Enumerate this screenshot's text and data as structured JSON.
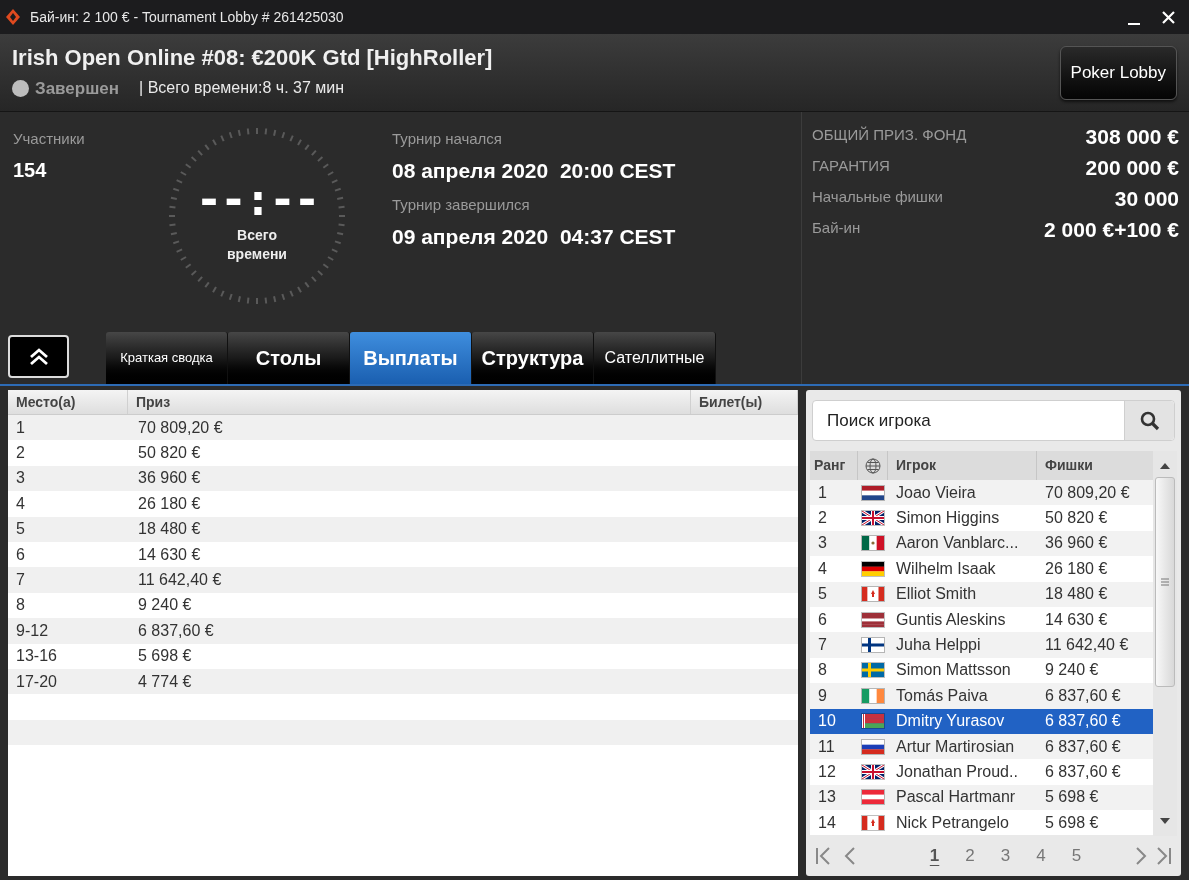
{
  "window": {
    "title": "Бай-ин: 2 100 € - Tournament Lobby # 261425030"
  },
  "header": {
    "title": "Irish Open Online #08: €200K Gtd [HighRoller]",
    "status": "Завершен",
    "duration": "| Всего времени:8 ч. 37 мин",
    "lobby_button": "Poker Lobby"
  },
  "info": {
    "participants_label": "Участники",
    "participants": "154",
    "clock": "--:--",
    "clock_caption": "Всего времени",
    "started_label": "Турнир начался",
    "started": "08 апреля 2020  20:00 CEST",
    "ended_label": "Турнир завершился",
    "ended": "09 апреля 2020  04:37 CEST",
    "stats": [
      {
        "label": "ОБЩИЙ ПРИЗ. ФОНД",
        "value": "308 000 €"
      },
      {
        "label": "ГАРАНТИЯ",
        "value": "200 000 €"
      },
      {
        "label": "Начальные фишки",
        "value": "30 000"
      },
      {
        "label": "Бай-ин",
        "value": "2 000 €+100 €"
      }
    ]
  },
  "tabs": [
    {
      "label": "Краткая сводка",
      "selected": false,
      "compact": true
    },
    {
      "label": "Столы",
      "selected": false,
      "compact": false
    },
    {
      "label": "Выплаты",
      "selected": true,
      "compact": false
    },
    {
      "label": "Структура",
      "selected": false,
      "compact": false
    },
    {
      "label": "Сателлитные",
      "selected": false,
      "compact": true
    }
  ],
  "payouts": {
    "columns": [
      "Место(а)",
      "Приз",
      "Билет(ы)"
    ],
    "rows": [
      [
        "1",
        "70 809,20 €"
      ],
      [
        "2",
        "50 820 €"
      ],
      [
        "3",
        "36 960 €"
      ],
      [
        "4",
        "26 180 €"
      ],
      [
        "5",
        "18 480 €"
      ],
      [
        "6",
        "14 630 €"
      ],
      [
        "7",
        "11 642,40 €"
      ],
      [
        "8",
        "9 240 €"
      ],
      [
        "9-12",
        "6 837,60 €"
      ],
      [
        "13-16",
        "5 698 €"
      ],
      [
        "17-20",
        "4 774 €"
      ]
    ]
  },
  "players": {
    "search": {
      "placeholder": "Поиск игрока"
    },
    "columns": [
      "Ранг",
      "Игрок",
      "Фишки"
    ],
    "rows": [
      {
        "rank": "1",
        "flag": {
          "kind": "nl"
        },
        "name": "Joao Vieira",
        "chips": "70 809,20 €",
        "selected": false
      },
      {
        "rank": "2",
        "flag": {
          "kind": "gb"
        },
        "name": "Simon Higgins",
        "chips": "50 820 €",
        "selected": false
      },
      {
        "rank": "3",
        "flag": {
          "kind": "mx"
        },
        "name": "Aaron Vanblarc...",
        "chips": "36 960 €",
        "selected": false
      },
      {
        "rank": "4",
        "flag": {
          "kind": "de"
        },
        "name": "Wilhelm Isaak",
        "chips": "26 180 €",
        "selected": false
      },
      {
        "rank": "5",
        "flag": {
          "kind": "ca"
        },
        "name": "Elliot Smith",
        "chips": "18 480 €",
        "selected": false
      },
      {
        "rank": "6",
        "flag": {
          "kind": "lv"
        },
        "name": "Guntis Aleskins",
        "chips": "14 630 €",
        "selected": false
      },
      {
        "rank": "7",
        "flag": {
          "kind": "fi"
        },
        "name": "Juha Helppi",
        "chips": "11 642,40 €",
        "selected": false
      },
      {
        "rank": "8",
        "flag": {
          "kind": "se"
        },
        "name": "Simon Mattsson",
        "chips": "9 240 €",
        "selected": false
      },
      {
        "rank": "9",
        "flag": {
          "kind": "ie"
        },
        "name": "Tomás Paiva",
        "chips": "6 837,60 €",
        "selected": false
      },
      {
        "rank": "10",
        "flag": {
          "kind": "by"
        },
        "name": "Dmitry Yurasov",
        "chips": "6 837,60 €",
        "selected": true
      },
      {
        "rank": "11",
        "flag": {
          "kind": "ru"
        },
        "name": "Artur Martirosian",
        "chips": "6 837,60 €",
        "selected": false
      },
      {
        "rank": "12",
        "flag": {
          "kind": "gb"
        },
        "name": "Jonathan Proud..",
        "chips": "6 837,60 €",
        "selected": false
      },
      {
        "rank": "13",
        "flag": {
          "kind": "at"
        },
        "name": "Pascal Hartmanr",
        "chips": "5 698 €",
        "selected": false
      },
      {
        "rank": "14",
        "flag": {
          "kind": "ca"
        },
        "name": "Nick Petrangelo",
        "chips": "5 698 €",
        "selected": false
      }
    ],
    "pages": [
      {
        "label": "1",
        "selected": true
      },
      {
        "label": "2",
        "selected": false
      },
      {
        "label": "3",
        "selected": false
      },
      {
        "label": "4",
        "selected": false
      },
      {
        "label": "5",
        "selected": false
      }
    ]
  }
}
